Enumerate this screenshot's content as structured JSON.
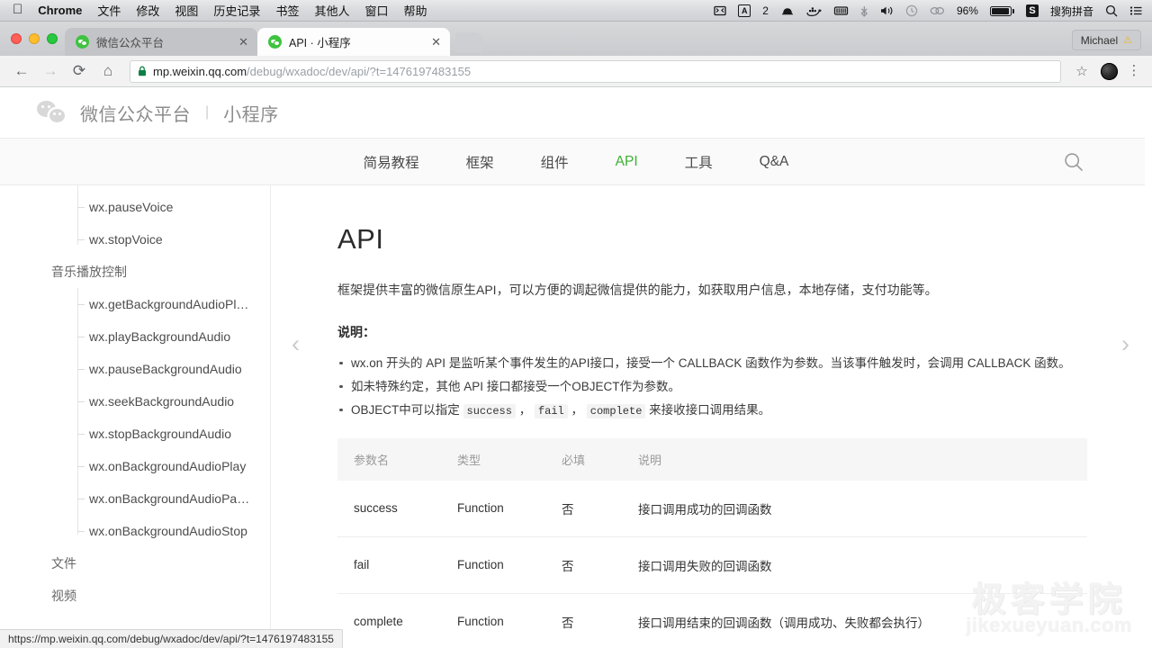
{
  "os_menubar": {
    "apple_icon": "apple-logo",
    "items": [
      "Chrome",
      "文件",
      "修改",
      "视图",
      "历史记录",
      "书签",
      "其他人",
      "窗口",
      "帮助"
    ],
    "status_icons": [
      {
        "name": "screen-mirroring-icon",
        "glyph": "⧉"
      },
      {
        "name": "adobe-photoshop-icon",
        "glyph": "A"
      },
      {
        "name": "photoshop-count",
        "glyph": "2"
      },
      {
        "name": "bowler-hat-icon",
        "glyph": "●"
      },
      {
        "name": "docker-icon",
        "glyph": "▣"
      },
      {
        "name": "time-machine-icon",
        "glyph": "▥"
      },
      {
        "name": "bluetooth-icon",
        "glyph": "᯽"
      },
      {
        "name": "volume-icon",
        "glyph": "🔊"
      },
      {
        "name": "clock-icon",
        "glyph": "◷"
      }
    ],
    "battery_percent": "96%",
    "input_method": "搜狗拼音",
    "search_icon": "spotlight-search-icon",
    "notification_icon": "notification-center-icon"
  },
  "browser": {
    "tabs": [
      {
        "title": "微信公众平台",
        "active": false
      },
      {
        "title": "API · 小程序",
        "active": true
      }
    ],
    "close_glyph": "✕",
    "profile_name": "Michael",
    "nav": {
      "back": "←",
      "forward": "→",
      "reload": "⟳",
      "home": "⌂"
    },
    "url": {
      "scheme": "https://",
      "host": "mp.weixin.qq.com",
      "path": "/debug/wxadoc/dev/api/?t=1476197483155"
    },
    "star_glyph": "☆",
    "menu_glyph": "⋮",
    "status_url": "https://mp.weixin.qq.com/debug/wxadoc/dev/api/?t=1476197483155"
  },
  "site_header": {
    "brand": "微信公众平台",
    "separator": "|",
    "sub_brand": "小程序"
  },
  "site_nav": {
    "items": [
      {
        "label": "简易教程",
        "active": false
      },
      {
        "label": "框架",
        "active": false
      },
      {
        "label": "组件",
        "active": false
      },
      {
        "label": "API",
        "active": true
      },
      {
        "label": "工具",
        "active": false
      },
      {
        "label": "Q&A",
        "active": false
      }
    ],
    "search_icon": "search-icon",
    "active_color": "#3cb034"
  },
  "sidebar": {
    "items": [
      {
        "label": "wx.pauseVoice",
        "type": "child"
      },
      {
        "label": "wx.stopVoice",
        "type": "child"
      },
      {
        "label": "音乐播放控制",
        "type": "group"
      },
      {
        "label": "wx.getBackgroundAudioPl…",
        "type": "child"
      },
      {
        "label": "wx.playBackgroundAudio",
        "type": "child"
      },
      {
        "label": "wx.pauseBackgroundAudio",
        "type": "child"
      },
      {
        "label": "wx.seekBackgroundAudio",
        "type": "child"
      },
      {
        "label": "wx.stopBackgroundAudio",
        "type": "child"
      },
      {
        "label": "wx.onBackgroundAudioPlay",
        "type": "child"
      },
      {
        "label": "wx.onBackgroundAudioPa…",
        "type": "child"
      },
      {
        "label": "wx.onBackgroundAudioStop",
        "type": "child"
      },
      {
        "label": "文件",
        "type": "group"
      },
      {
        "label": "视频",
        "type": "group"
      }
    ]
  },
  "main": {
    "title": "API",
    "intro": "框架提供丰富的微信原生API，可以方便的调起微信提供的能力，如获取用户信息，本地存储，支付功能等。",
    "note_label": "说明：",
    "notes": [
      {
        "parts": [
          {
            "t": "wx.on 开头的 API 是监听某个事件发生的API接口，接受一个 CALLBACK 函数作为参数。当该事件触发时，会调用 CALLBACK 函数。",
            "code": false
          }
        ]
      },
      {
        "parts": [
          {
            "t": "如未特殊约定，其他 API 接口都接受一个OBJECT作为参数。",
            "code": false
          }
        ]
      },
      {
        "parts": [
          {
            "t": "OBJECT中可以指定 ",
            "code": false
          },
          {
            "t": "success",
            "code": true
          },
          {
            "t": " ， ",
            "code": false
          },
          {
            "t": "fail",
            "code": true
          },
          {
            "t": " ， ",
            "code": false
          },
          {
            "t": "complete",
            "code": true
          },
          {
            "t": " 来接收接口调用结果。",
            "code": false
          }
        ]
      }
    ],
    "table": {
      "headers": [
        "参数名",
        "类型",
        "必填",
        "说明"
      ],
      "rows": [
        [
          "success",
          "Function",
          "否",
          "接口调用成功的回调函数"
        ],
        [
          "fail",
          "Function",
          "否",
          "接口调用失败的回调函数"
        ],
        [
          "complete",
          "Function",
          "否",
          "接口调用结束的回调函数（调用成功、失败都会执行）"
        ]
      ]
    },
    "pager": {
      "prev": "‹",
      "next": "›"
    }
  },
  "watermark": {
    "cn": "极客学院",
    "en": "jikexueyuan.com"
  }
}
